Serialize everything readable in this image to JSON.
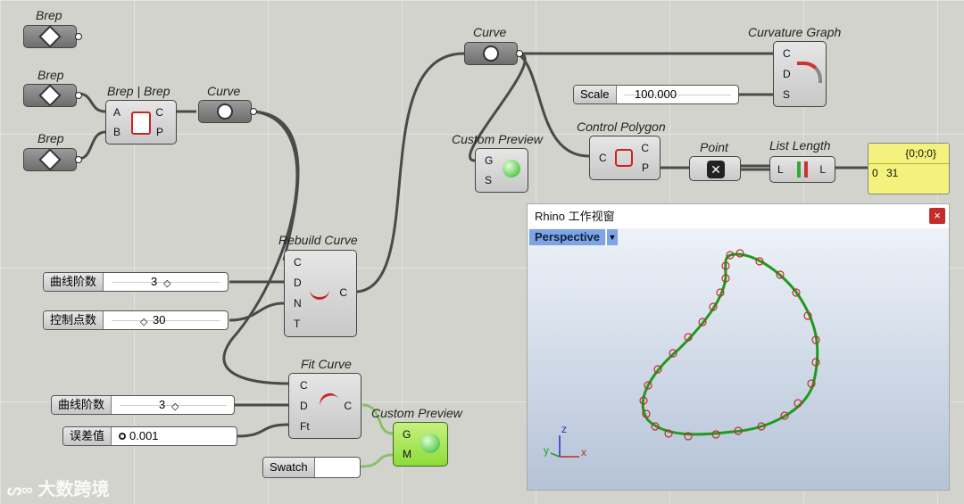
{
  "components": {
    "brep1": {
      "label": "Brep"
    },
    "brep2": {
      "label": "Brep"
    },
    "brep3": {
      "label": "Brep"
    },
    "brep_brep": {
      "label": "Brep | Brep",
      "in": [
        "A",
        "B"
      ],
      "out": [
        "C",
        "P"
      ]
    },
    "curve1": {
      "label": "Curve"
    },
    "curve2": {
      "label": "Curve"
    },
    "curvature_graph": {
      "label": "Curvature Graph",
      "in": [
        "C",
        "D",
        "S"
      ]
    },
    "scale_slider": {
      "name": "Scale",
      "value": "100.000"
    },
    "custom_preview1": {
      "label": "Custom Preview",
      "in": [
        "G",
        "S"
      ]
    },
    "control_polygon": {
      "label": "Control Polygon",
      "in": [
        "C"
      ],
      "out": [
        "C",
        "P"
      ]
    },
    "point": {
      "label": "Point"
    },
    "list_length": {
      "label": "List Length",
      "in": [
        "L"
      ],
      "out": [
        "L"
      ]
    },
    "panel": {
      "header": "{0;0;0}",
      "index": "0",
      "value": "31"
    },
    "rebuild_curve": {
      "label": "Rebuild Curve",
      "in": [
        "C",
        "D",
        "N",
        "T"
      ],
      "out": [
        "C"
      ]
    },
    "slider_degree1": {
      "name": "曲线阶数",
      "value": "3"
    },
    "slider_points": {
      "name": "控制点数",
      "value": "30"
    },
    "fit_curve": {
      "label": "Fit Curve",
      "in": [
        "C",
        "D",
        "Ft"
      ],
      "out": [
        "C"
      ]
    },
    "slider_degree2": {
      "name": "曲线阶数",
      "value": "3"
    },
    "slider_tolerance": {
      "name": "误差值",
      "value": "0.001"
    },
    "custom_preview2": {
      "label": "Custom Preview",
      "in": [
        "G",
        "M"
      ]
    },
    "swatch": {
      "name": "Swatch",
      "color": "#ffffff"
    }
  },
  "viewport": {
    "title": "Rhino 工作视窗",
    "close": "×",
    "view_name": "Perspective",
    "axis_x": "x",
    "axis_y": "y",
    "axis_z": "z"
  },
  "watermark": {
    "text": "大数跨境"
  },
  "colors": {
    "curve": "#1f9a1f",
    "control_point": "#c42b2b",
    "wire": "#4a4a4a",
    "wire_selected": "#8bc06a"
  }
}
